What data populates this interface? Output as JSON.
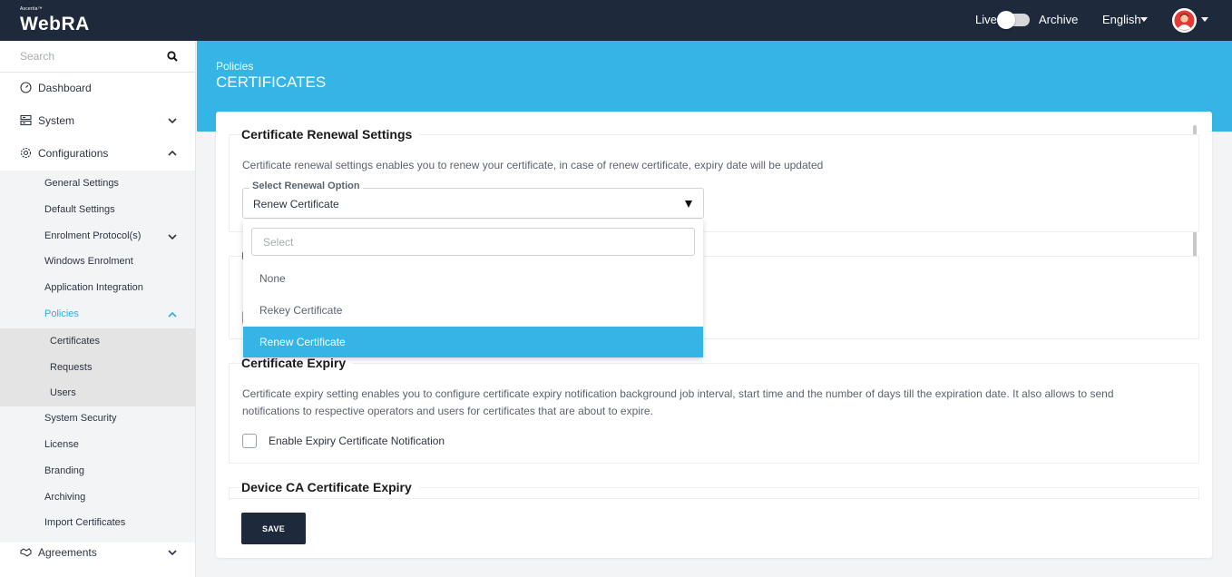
{
  "app": {
    "brand_sup": "Ascertia™",
    "brand_name": "WebRA"
  },
  "header": {
    "live_label": "Live",
    "archive_label": "Archive",
    "language": "English"
  },
  "sidebar": {
    "search_placeholder": "Search",
    "items": {
      "dashboard": "Dashboard",
      "system": "System",
      "configurations": "Configurations",
      "agreements": "Agreements"
    },
    "config_sub": [
      "General Settings",
      "Default Settings",
      "Enrolment Protocol(s)",
      "Windows Enrolment",
      "Application Integration",
      "Policies",
      "System Security",
      "License",
      "Branding",
      "Archiving",
      "Import Certificates"
    ],
    "policies_sub": [
      "Certificates",
      "Requests",
      "Users"
    ]
  },
  "page": {
    "breadcrumb": "Policies",
    "title": "CERTIFICATES"
  },
  "renewal": {
    "title": "Certificate Renewal Settings",
    "description": "Certificate renewal settings enables you to renew your certificate, in case of renew certificate, expiry date will be updated",
    "select_label": "Select Renewal Option",
    "select_value": "Renew Certificate",
    "dropdown_search_placeholder": "Select",
    "options": [
      "None",
      "Rekey Certificate",
      "Renew Certificate"
    ],
    "selected_option": "Renew Certificate"
  },
  "expiry": {
    "title": "Certificate Expiry",
    "description_line1": "Certificate expiry setting enables you to configure certificate expiry notification background job interval, start time and the number of days till the expiration date. It also allows to send",
    "description_line2": "notifications to respective operators and users for certificates that are about to expire.",
    "checkbox_label": "Enable Expiry Certificate Notification"
  },
  "device_ca": {
    "title": "Device CA Certificate Expiry"
  },
  "actions": {
    "save_label": "SAVE"
  },
  "colors": {
    "topbar": "#1e2a3b",
    "accent": "#35b5e5",
    "active_text": "#2aaee0"
  }
}
